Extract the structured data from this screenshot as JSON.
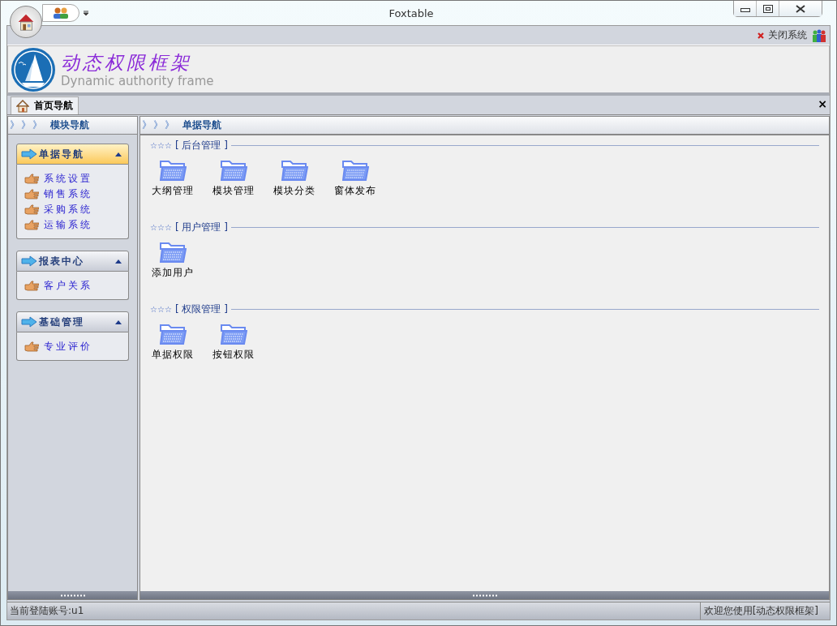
{
  "window": {
    "title": "Foxtable"
  },
  "toolbar": {
    "close_system": "关闭系统"
  },
  "banner": {
    "title": "动态权限框架",
    "subtitle": "Dynamic authority frame"
  },
  "tabs": [
    {
      "label": "首页导航",
      "selected": true
    }
  ],
  "tab_close": "×",
  "sidebar": {
    "header_marks": "》》》",
    "title": "模块导航",
    "groups": [
      {
        "label": "单据导航",
        "selected": true,
        "expanded": true,
        "items": [
          "系统设置",
          "销售系统",
          "采购系统",
          "运输系统"
        ]
      },
      {
        "label": "报表中心",
        "selected": false,
        "expanded": true,
        "items": [
          "客户关系"
        ]
      },
      {
        "label": "基础管理",
        "selected": false,
        "expanded": true,
        "items": [
          "专业评价"
        ]
      }
    ]
  },
  "main": {
    "header_marks": "》》》",
    "title": "单据导航",
    "sections": [
      {
        "stars": "☆☆☆",
        "title": "[ 后台管理 ]",
        "items": [
          "大纲管理",
          "模块管理",
          "模块分类",
          "窗体发布"
        ]
      },
      {
        "stars": "☆☆☆",
        "title": "[ 用户管理 ]",
        "items": [
          "添加用户"
        ]
      },
      {
        "stars": "☆☆☆",
        "title": "[ 权限管理 ]",
        "items": [
          "单据权限",
          "按钮权限"
        ]
      }
    ]
  },
  "status_bar": {
    "left": "当前登陆账号:u1",
    "right": "欢迎您使用[动态权限框架]"
  }
}
